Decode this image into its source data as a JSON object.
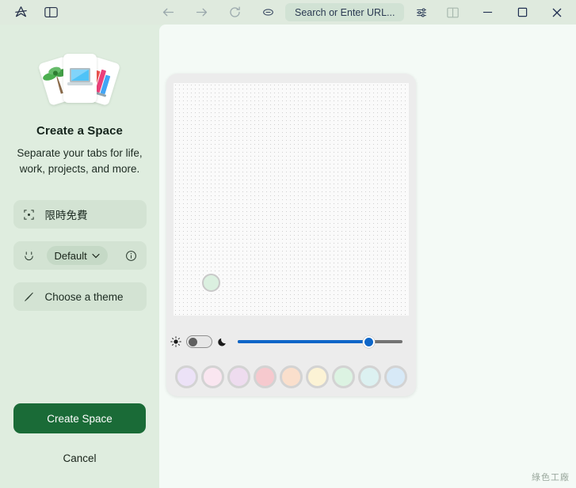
{
  "titlebar": {
    "logo_name": "arc-logo-icon",
    "sidebar_toggle_name": "sidebar-toggle-icon",
    "back_label": "Back",
    "forward_label": "Forward",
    "reload_label": "Reload",
    "shield_label": "Extensions",
    "url_text": "Search or Enter URL...",
    "url_placeholder": "Search or Enter URL...",
    "tune_label": "Settings",
    "split_label": "Split view",
    "minimize_label": "Minimize",
    "maximize_label": "Maximize",
    "close_label": "Close"
  },
  "sidebar": {
    "title": "Create a Space",
    "subtitle": "Separate your tabs for life, work, projects, and more.",
    "rows": [
      {
        "icon": "emoji-placeholder-icon",
        "label": "限時免費"
      },
      {
        "icon": "profile-face-icon",
        "pill_label": "Default",
        "info_icon": "info-circle-icon"
      },
      {
        "icon": "paintbrush-icon",
        "label": "Choose a theme"
      }
    ],
    "create_label": "Create Space",
    "cancel_label": "Cancel"
  },
  "theme_picker": {
    "mode_light_icon": "sun-icon",
    "mode_dark_icon": "moon-icon",
    "toggle_state": "light",
    "slider_value": 80,
    "selected_swatch_color": "#dbf0e0",
    "swatches": [
      "#ece2f7",
      "#fae6f0",
      "#eedcef",
      "#f6c9ce",
      "#fadfcc",
      "#fcf3d5",
      "#dcf3e2",
      "#dcf1f1",
      "#d7e9f7"
    ],
    "accent_color": "#0d66c8"
  },
  "colors": {
    "brand_green": "#1a6b37",
    "sidebar_bg": "#dfeddf",
    "content_bg": "#f4faf6"
  },
  "watermark": {
    "text": "綠色工廠"
  }
}
